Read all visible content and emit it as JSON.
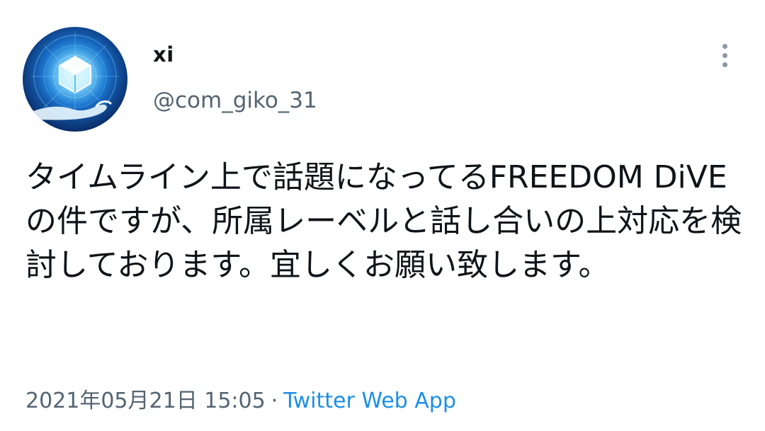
{
  "tweet": {
    "author": {
      "display_name": "xi",
      "handle": "@com_giko_31",
      "avatar_icon": "glowing-cube-over-hand-avatar"
    },
    "menu_icon": "more-vertical-icon",
    "text": "タイムライン上で話題になってるFREEDOM DiVEの件ですが、所属レーベルと話し合いの上対応を検討しております。宜しくお願い致します。",
    "timestamp": "2021年05月21日 15:05",
    "separator": "·",
    "source": "Twitter Web App"
  },
  "colors": {
    "text": "#0f1419",
    "secondary": "#536471",
    "link": "#1d8fe8",
    "background": "#ffffff"
  }
}
